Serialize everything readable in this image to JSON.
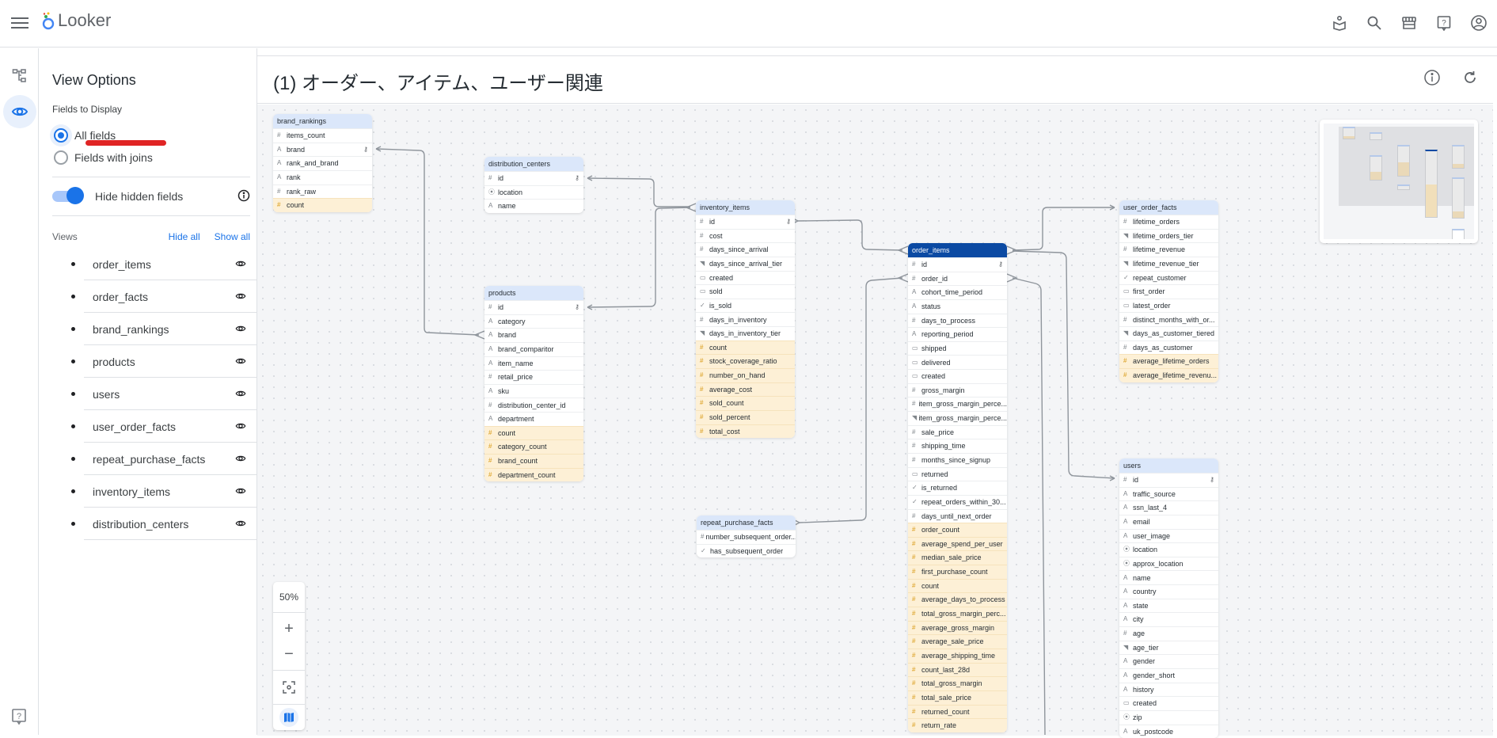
{
  "app": {
    "name": "Looker",
    "header_icons": [
      "learning-icon",
      "search-icon",
      "marketplace-icon",
      "help-icon",
      "account-icon"
    ]
  },
  "rail": {
    "items": [
      {
        "name": "explore-tree-icon",
        "active": false
      },
      {
        "name": "view-options-eye-icon",
        "active": true
      }
    ],
    "help": "help-icon"
  },
  "panel": {
    "title": "View Options",
    "fields_label": "Fields to Display",
    "radio_all": "All fields",
    "radio_joins": "Fields with joins",
    "selected_radio": "All fields",
    "toggle_label": "Hide hidden fields",
    "toggle_on": true,
    "views_label": "Views",
    "hide_all": "Hide all",
    "show_all": "Show all",
    "views": [
      "order_items",
      "order_facts",
      "brand_rankings",
      "products",
      "users",
      "user_order_facts",
      "repeat_purchase_facts",
      "inventory_items",
      "distribution_centers"
    ]
  },
  "main": {
    "title": "(1) オーダー、アイテム、ユーザー関連",
    "zoom_level": "50%",
    "zoom_in": "+",
    "zoom_out": "−"
  },
  "colors": {
    "accent": "#1a73e8",
    "selected_header": "#0b4aa3",
    "view_header": "#dbe7fa",
    "measure_bg": "#fdf0d6",
    "measure_icon": "#d99b17",
    "annotation": "#e02424"
  },
  "diagram": {
    "views": [
      {
        "id": "brand_rankings",
        "fields": [
          {
            "n": "items_count",
            "t": "num"
          },
          {
            "n": "brand",
            "t": "str",
            "key": true
          },
          {
            "n": "rank_and_brand",
            "t": "str"
          },
          {
            "n": "rank",
            "t": "str"
          },
          {
            "n": "rank_raw",
            "t": "num"
          },
          {
            "n": "count",
            "t": "num",
            "m": true
          }
        ]
      },
      {
        "id": "distribution_centers",
        "fields": [
          {
            "n": "id",
            "t": "num",
            "key": true
          },
          {
            "n": "location",
            "t": "loc"
          },
          {
            "n": "name",
            "t": "str"
          }
        ]
      },
      {
        "id": "products",
        "fields": [
          {
            "n": "id",
            "t": "num",
            "key": true
          },
          {
            "n": "category",
            "t": "str"
          },
          {
            "n": "brand",
            "t": "str"
          },
          {
            "n": "brand_comparitor",
            "t": "str"
          },
          {
            "n": "item_name",
            "t": "str"
          },
          {
            "n": "retail_price",
            "t": "num"
          },
          {
            "n": "sku",
            "t": "str"
          },
          {
            "n": "distribution_center_id",
            "t": "num"
          },
          {
            "n": "department",
            "t": "str"
          },
          {
            "n": "count",
            "t": "num",
            "m": true
          },
          {
            "n": "category_count",
            "t": "num",
            "m": true
          },
          {
            "n": "brand_count",
            "t": "num",
            "m": true
          },
          {
            "n": "department_count",
            "t": "num",
            "m": true
          }
        ]
      },
      {
        "id": "inventory_items",
        "fields": [
          {
            "n": "id",
            "t": "num",
            "key": true
          },
          {
            "n": "cost",
            "t": "num"
          },
          {
            "n": "days_since_arrival",
            "t": "num"
          },
          {
            "n": "days_since_arrival_tier",
            "t": "tier"
          },
          {
            "n": "created",
            "t": "date"
          },
          {
            "n": "sold",
            "t": "date"
          },
          {
            "n": "is_sold",
            "t": "bool"
          },
          {
            "n": "days_in_inventory",
            "t": "num"
          },
          {
            "n": "days_in_inventory_tier",
            "t": "tier"
          },
          {
            "n": "count",
            "t": "num",
            "m": true
          },
          {
            "n": "stock_coverage_ratio",
            "t": "num",
            "m": true
          },
          {
            "n": "number_on_hand",
            "t": "num",
            "m": true
          },
          {
            "n": "average_cost",
            "t": "num",
            "m": true
          },
          {
            "n": "sold_count",
            "t": "num",
            "m": true
          },
          {
            "n": "sold_percent",
            "t": "num",
            "m": true
          },
          {
            "n": "total_cost",
            "t": "num",
            "m": true
          }
        ]
      },
      {
        "id": "repeat_purchase_facts",
        "fields": [
          {
            "n": "number_subsequent_order...",
            "t": "num"
          },
          {
            "n": "has_subsequent_order",
            "t": "bool"
          }
        ]
      },
      {
        "id": "order_items",
        "selected": true,
        "fields": [
          {
            "n": "id",
            "t": "num",
            "key": true
          },
          {
            "n": "order_id",
            "t": "num"
          },
          {
            "n": "cohort_time_period",
            "t": "str"
          },
          {
            "n": "status",
            "t": "str"
          },
          {
            "n": "days_to_process",
            "t": "num"
          },
          {
            "n": "reporting_period",
            "t": "str"
          },
          {
            "n": "shipped",
            "t": "date"
          },
          {
            "n": "delivered",
            "t": "date"
          },
          {
            "n": "created",
            "t": "date"
          },
          {
            "n": "gross_margin",
            "t": "num"
          },
          {
            "n": "item_gross_margin_perce...",
            "t": "num"
          },
          {
            "n": "item_gross_margin_perce...",
            "t": "tier"
          },
          {
            "n": "sale_price",
            "t": "num"
          },
          {
            "n": "shipping_time",
            "t": "num"
          },
          {
            "n": "months_since_signup",
            "t": "num"
          },
          {
            "n": "returned",
            "t": "date"
          },
          {
            "n": "is_returned",
            "t": "bool"
          },
          {
            "n": "repeat_orders_within_30...",
            "t": "bool"
          },
          {
            "n": "days_until_next_order",
            "t": "num"
          },
          {
            "n": "order_count",
            "t": "num",
            "m": true
          },
          {
            "n": "average_spend_per_user",
            "t": "num",
            "m": true
          },
          {
            "n": "median_sale_price",
            "t": "num",
            "m": true
          },
          {
            "n": "first_purchase_count",
            "t": "num",
            "m": true
          },
          {
            "n": "count",
            "t": "num",
            "m": true
          },
          {
            "n": "average_days_to_process",
            "t": "num",
            "m": true
          },
          {
            "n": "total_gross_margin_perc...",
            "t": "num",
            "m": true
          },
          {
            "n": "average_gross_margin",
            "t": "num",
            "m": true
          },
          {
            "n": "average_sale_price",
            "t": "num",
            "m": true
          },
          {
            "n": "average_shipping_time",
            "t": "num",
            "m": true
          },
          {
            "n": "count_last_28d",
            "t": "num",
            "m": true
          },
          {
            "n": "total_gross_margin",
            "t": "num",
            "m": true
          },
          {
            "n": "total_sale_price",
            "t": "num",
            "m": true
          },
          {
            "n": "returned_count",
            "t": "num",
            "m": true
          },
          {
            "n": "return_rate",
            "t": "num",
            "m": true
          }
        ]
      },
      {
        "id": "user_order_facts",
        "fields": [
          {
            "n": "lifetime_orders",
            "t": "num"
          },
          {
            "n": "lifetime_orders_tier",
            "t": "tier"
          },
          {
            "n": "lifetime_revenue",
            "t": "num"
          },
          {
            "n": "lifetime_revenue_tier",
            "t": "tier"
          },
          {
            "n": "repeat_customer",
            "t": "bool"
          },
          {
            "n": "first_order",
            "t": "date"
          },
          {
            "n": "latest_order",
            "t": "date"
          },
          {
            "n": "distinct_months_with_or...",
            "t": "num"
          },
          {
            "n": "days_as_customer_tiered",
            "t": "tier"
          },
          {
            "n": "days_as_customer",
            "t": "num"
          },
          {
            "n": "average_lifetime_orders",
            "t": "num",
            "m": true
          },
          {
            "n": "average_lifetime_revenu...",
            "t": "num",
            "m": true
          }
        ]
      },
      {
        "id": "users",
        "fields": [
          {
            "n": "id",
            "t": "num",
            "key": true
          },
          {
            "n": "traffic_source",
            "t": "str"
          },
          {
            "n": "ssn_last_4",
            "t": "str"
          },
          {
            "n": "email",
            "t": "str"
          },
          {
            "n": "user_image",
            "t": "str"
          },
          {
            "n": "location",
            "t": "loc"
          },
          {
            "n": "approx_location",
            "t": "loc"
          },
          {
            "n": "name",
            "t": "str"
          },
          {
            "n": "country",
            "t": "str"
          },
          {
            "n": "state",
            "t": "str"
          },
          {
            "n": "city",
            "t": "str"
          },
          {
            "n": "age",
            "t": "num"
          },
          {
            "n": "age_tier",
            "t": "tier"
          },
          {
            "n": "gender",
            "t": "str"
          },
          {
            "n": "gender_short",
            "t": "str"
          },
          {
            "n": "history",
            "t": "str"
          },
          {
            "n": "created",
            "t": "date"
          },
          {
            "n": "zip",
            "t": "loc"
          },
          {
            "n": "uk_postcode",
            "t": "str"
          }
        ]
      }
    ],
    "joins": [
      {
        "from": "products.brand",
        "to": "brand_rankings.brand"
      },
      {
        "from": "inventory_items",
        "to": "distribution_centers.id"
      },
      {
        "from": "inventory_items",
        "to": "products.id"
      },
      {
        "from": "order_items",
        "to": "inventory_items.id"
      },
      {
        "from": "order_items.order_id",
        "to": "repeat_purchase_facts"
      },
      {
        "from": "order_items",
        "to": "user_order_facts"
      },
      {
        "from": "order_items",
        "to": "users.id"
      }
    ]
  }
}
